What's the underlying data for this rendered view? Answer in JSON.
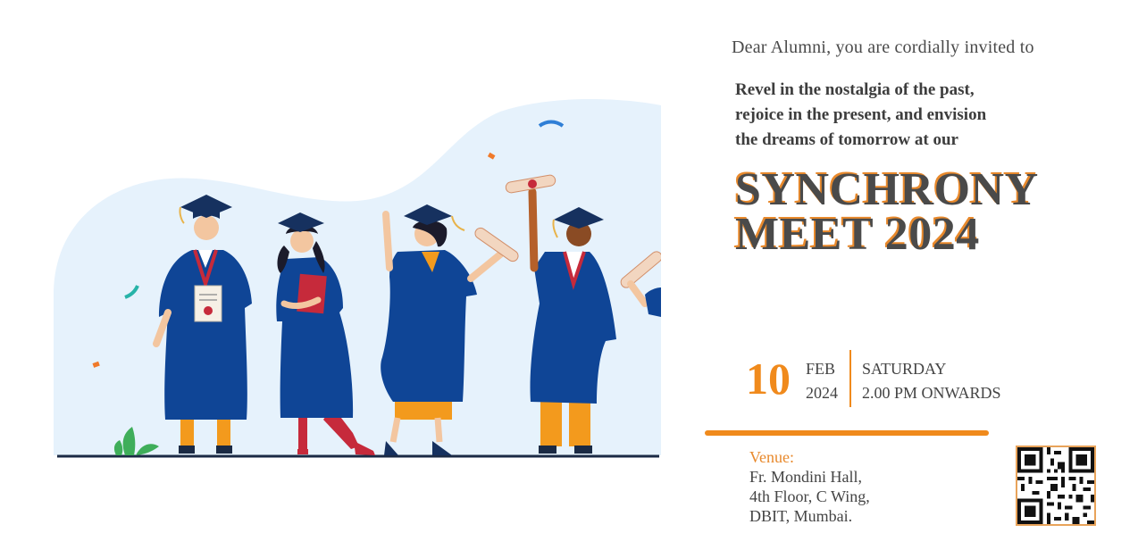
{
  "invitation": {
    "greeting": "Dear Alumni, you are cordially invited to",
    "tagline": [
      "Revel in the nostalgia of the past,",
      "rejoice in the present, and envision",
      "the dreams of tomorrow at our"
    ],
    "title_lines": [
      "SYNCHRONY",
      "MEET 2024"
    ]
  },
  "date": {
    "day": "10",
    "month": "FEB",
    "year": "2024",
    "weekday": "SATURDAY",
    "time": "2.00 PM ONWARDS"
  },
  "venue": {
    "label": "Venue:",
    "lines": [
      "Fr. Mondini Hall,",
      "4th Floor, C Wing,",
      "DBIT, Mumbai."
    ]
  },
  "colors": {
    "accent": "#f08a1c",
    "gown": "#0f4596",
    "text": "#444444",
    "blob": "#e6f2fc"
  },
  "icons": {
    "illustration": "graduates-celebrating-illustration",
    "qr": "qr-code-icon"
  }
}
